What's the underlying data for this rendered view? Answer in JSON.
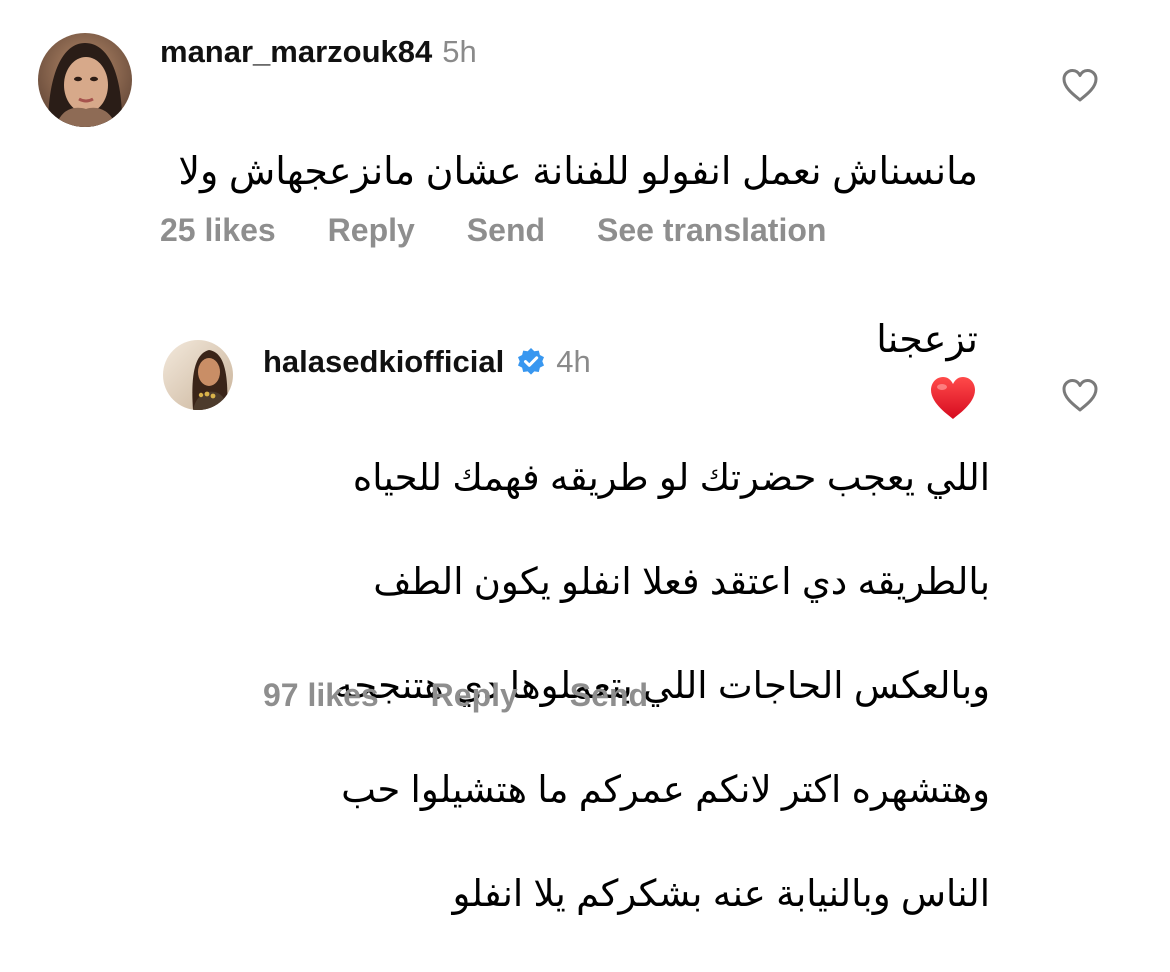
{
  "comments": [
    {
      "username": "manar_marzouk84",
      "time": "5h",
      "text_line1": "مانسناش نعمل انفولو للفنانة عشان مانزعجهاش ولا",
      "text_line2": "تزعجنا",
      "emoji": "red-heart",
      "likes": "25 likes",
      "reply": "Reply",
      "send": "Send",
      "translate": "See translation",
      "verified": false
    },
    {
      "username": "halasedkiofficial",
      "time": "4h",
      "text_lines": [
        "اللي يعجب حضرتك لو طريقه فهمك للحياه",
        "بالطريقه دي اعتقد فعلا انفلو يكون الطف",
        "وبالعكس الحاجات اللي بتعملوها دي هتنجحه",
        "وهتشهره اكتر لانكم عمركم ما هتشيلوا حب",
        "الناس وبالنيابة عنه بشكركم يلا انفلو"
      ],
      "likes": "97 likes",
      "reply": "Reply",
      "send": "Send",
      "verified": true
    }
  ],
  "colors": {
    "meta_gray": "#8e8e8e",
    "verified_blue": "#3897f0",
    "heart_red": "#e8112d"
  },
  "icons": {
    "like": "heart-outline-icon",
    "verified": "verified-badge-icon"
  }
}
